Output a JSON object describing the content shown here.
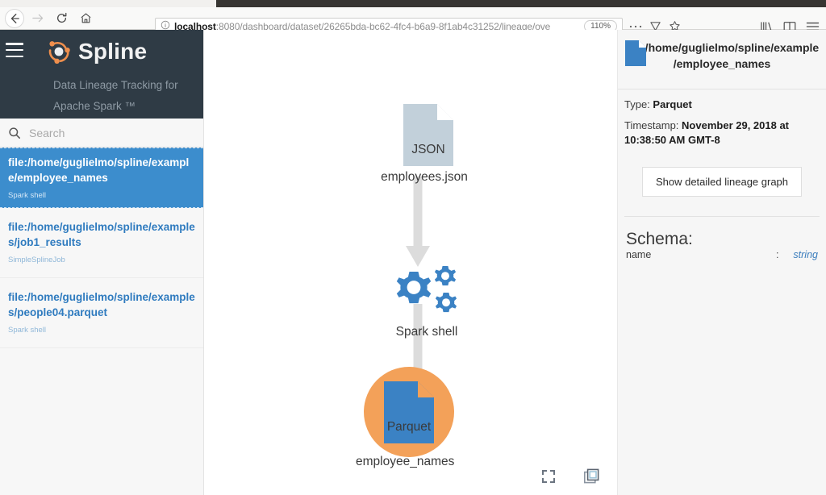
{
  "browser": {
    "back_label": "Back",
    "forward_label": "Forward",
    "reload_label": "Reload",
    "home_label": "Home",
    "url_host": "localhost",
    "url_rest": ":8080/dashboard/dataset/26265bda-bc62-4fc4-b6a9-8f1ab4c31252/lineage/ove",
    "zoom_level": "110%",
    "page_actions_label": "Page actions",
    "reader_label": "Reader view",
    "bookmark_label": "Bookmark this page",
    "library_label": "Library",
    "sidebar_label": "Sidebars",
    "menu_label": "Open menu"
  },
  "sidebar": {
    "menu_toggle_label": "Toggle menu",
    "brand_name": "Spline",
    "brand_tagline_line1": "Data Lineage Tracking for",
    "brand_tagline_line2": "Apache Spark ™",
    "search_placeholder": "Search",
    "search_value": "",
    "items": [
      {
        "title": "file:/home/guglielmo/spline/example/employee_names",
        "subtitle": "Spark shell",
        "selected": true
      },
      {
        "title": "file:/home/guglielmo/spline/examples/job1_results",
        "subtitle": "SimpleSplineJob",
        "selected": false
      },
      {
        "title": "file:/home/guglielmo/spline/examples/people04.parquet",
        "subtitle": "Spark shell",
        "selected": false
      }
    ]
  },
  "graph": {
    "nodes": [
      {
        "id": "json",
        "type_label": "JSON",
        "label": "employees.json",
        "kind": "datasource"
      },
      {
        "id": "op",
        "type_label": "",
        "label": "Spark shell",
        "kind": "operation"
      },
      {
        "id": "parquet",
        "type_label": "Parquet",
        "label": "employee_names",
        "kind": "datasource-selected"
      }
    ],
    "controls": {
      "fit_label": "Fit to screen",
      "copy_label": "Duplicate view"
    }
  },
  "details": {
    "title": "file:/home/guglielmo/spline/example/employee_names",
    "file_icon_label": "parquet-file",
    "type_label": "Type:",
    "type_value": "Parquet",
    "timestamp_label": "Timestamp:",
    "timestamp_value": "November 29, 2018 at 10:38:50 AM GMT-8",
    "detail_button_label": "Show detailed lineage graph",
    "schema_heading": "Schema:",
    "schema_fields": [
      {
        "name": "name",
        "separator": ":",
        "type": "string"
      }
    ]
  },
  "colors": {
    "accent_orange": "#f3a159",
    "brand_dark": "#2f3b45",
    "selected_blue": "#3c8dcd",
    "node_blue": "#3b82c4",
    "node_gray_blue": "#c2d0da",
    "link_blue": "#2f7bbf"
  }
}
